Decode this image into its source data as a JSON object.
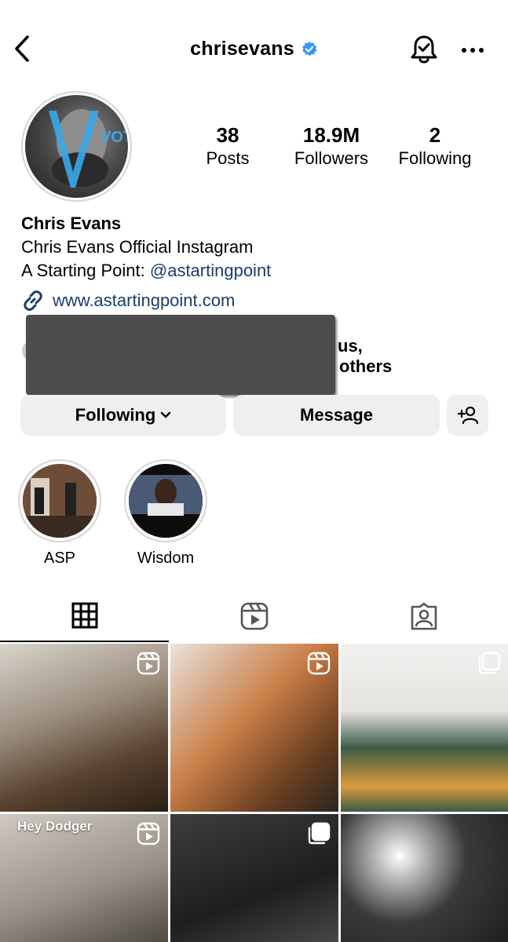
{
  "header": {
    "username": "chrisevans",
    "verified": true
  },
  "avatar": {
    "overlay_text": "VOTE"
  },
  "stats": {
    "posts": {
      "value": "38",
      "label": "Posts"
    },
    "followers": {
      "value": "18.9M",
      "label": "Followers"
    },
    "following": {
      "value": "2",
      "label": "Following"
    }
  },
  "bio": {
    "name": "Chris Evans",
    "line1": "Chris Evans Official Instagram",
    "line2_prefix": "A Starting Point: ",
    "line2_mention": "@astartingpoint",
    "link": "www.astartingpoint.com"
  },
  "followed_by": {
    "visible_fragment_1": "us,",
    "visible_fragment_2": "others"
  },
  "actions": {
    "following_label": "Following",
    "message_label": "Message"
  },
  "highlights": [
    {
      "label": "ASP"
    },
    {
      "label": "Wisdom"
    }
  ],
  "grid": {
    "posts": [
      {
        "type": "reel",
        "caption": ""
      },
      {
        "type": "reel",
        "caption": ""
      },
      {
        "type": "carousel",
        "caption": ""
      },
      {
        "type": "reel",
        "caption": "Hey Dodger"
      },
      {
        "type": "carousel",
        "caption": ""
      },
      {
        "type": "photo",
        "caption": ""
      }
    ]
  },
  "colors": {
    "link": "#1a3d6e",
    "verified": "#3897f0",
    "button_bg": "#efefef",
    "avatar_accent": "#3aa6e8"
  },
  "icons": {
    "back": "chevron-left-icon",
    "verified": "verified-badge-icon",
    "bell": "bell-check-icon",
    "more": "more-horizontal-icon",
    "link": "link-chain-icon",
    "add_user": "add-user-icon",
    "grid_tab": "grid-icon",
    "reels_tab": "reels-icon",
    "tagged_tab": "tagged-person-icon",
    "reel_badge": "reel-icon",
    "carousel_badge": "carousel-icon"
  }
}
